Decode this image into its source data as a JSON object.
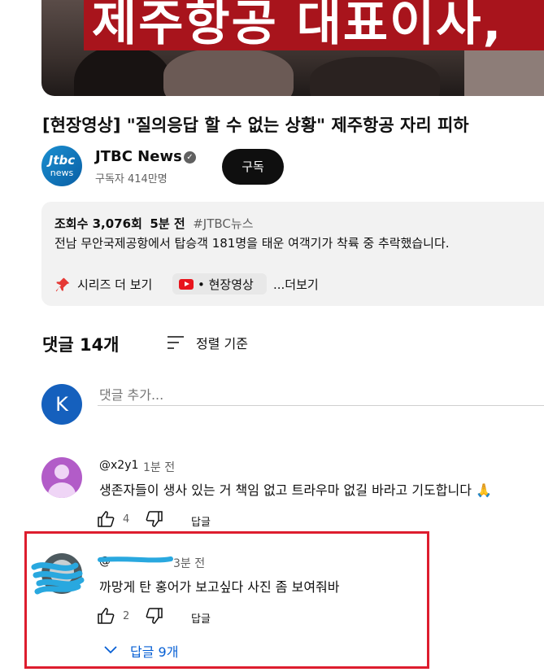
{
  "video": {
    "banner_text": "제주항공 대표이사,",
    "title": "[현장영상] \"질의응답 할 수 없는 상황\" 제주항공 자리 피하"
  },
  "channel": {
    "avatar_line1": "Jtbc",
    "avatar_line2": "news",
    "name": "JTBC News",
    "subscribers": "구독자 414만명",
    "subscribe_label": "구독"
  },
  "description": {
    "views": "조회수 3,076회",
    "time": "5분 전",
    "hashtag": "#JTBC뉴스",
    "text": "전남 무안국제공항에서 탑승객 181명을 태운 여객기가 착륙 중 추락했습니다.",
    "series_label": "시리즈 더 보기",
    "series_name": "• 현장영상",
    "more_label": "...더보기"
  },
  "comments_header": {
    "title": "댓글 14개",
    "sort_label": "정렬 기준"
  },
  "add_comment": {
    "avatar_letter": "K",
    "placeholder": "댓글 추가..."
  },
  "comments": [
    {
      "handle": "@x2y1",
      "time": "1분 전",
      "text": "생존자들이 생사 있는 거 책임 없고 트라우마 없길 바라고 기도합니다 🙏",
      "likes": "4",
      "reply_label": "답글"
    },
    {
      "handle": "@",
      "time": "3분 전",
      "text": "까망게 탄 홍어가 보고싶다 사진 좀 보여줘바",
      "likes": "2",
      "reply_label": "답글",
      "replies_label": "답글 9개"
    }
  ],
  "colors": {
    "subscribe_bg": "#0f0f0f",
    "link_blue": "#065fd4",
    "highlight_red": "#dd1d2e",
    "scribble_blue": "#29a8df",
    "user_avatar": "#1560bd"
  }
}
